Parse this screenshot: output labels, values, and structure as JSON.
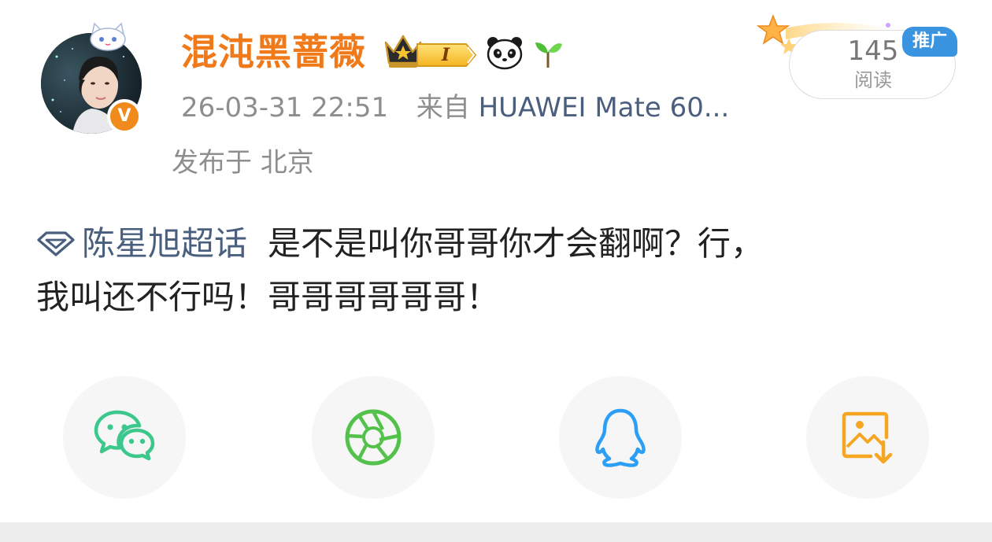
{
  "post": {
    "username": "混沌黑蔷薇",
    "level": "I",
    "timestamp": "26-03-31 22:51",
    "source_prefix": "来自",
    "device": "HUAWEI Mate 60...",
    "location": "发布于 北京",
    "read_count": "145",
    "read_label": "阅读",
    "promo_label": "推广",
    "topic": "陈星旭超话",
    "text_line1": "是不是叫你哥哥你才会翻啊？行，",
    "text_line2": "我叫还不行吗！哥哥哥哥哥哥！"
  },
  "icons": {
    "verified": "verified-v-icon",
    "crown": "crown-icon",
    "panda": "panda-icon",
    "sprout": "sprout-icon",
    "topic": "diamond-topic-icon"
  },
  "share": {
    "buttons": [
      {
        "icon": "wechat-icon",
        "color": "#3cc88c"
      },
      {
        "icon": "moments-icon",
        "color": "#53c24a"
      },
      {
        "icon": "qq-icon",
        "color": "#2b9ef6"
      },
      {
        "icon": "save-image-icon",
        "color": "#f5a623"
      }
    ]
  },
  "colors": {
    "username": "#f07a1a",
    "link": "#4a5e7e",
    "meta": "#8e8e8e",
    "promo": "#3a94e0",
    "verified": "#f08a1c"
  }
}
